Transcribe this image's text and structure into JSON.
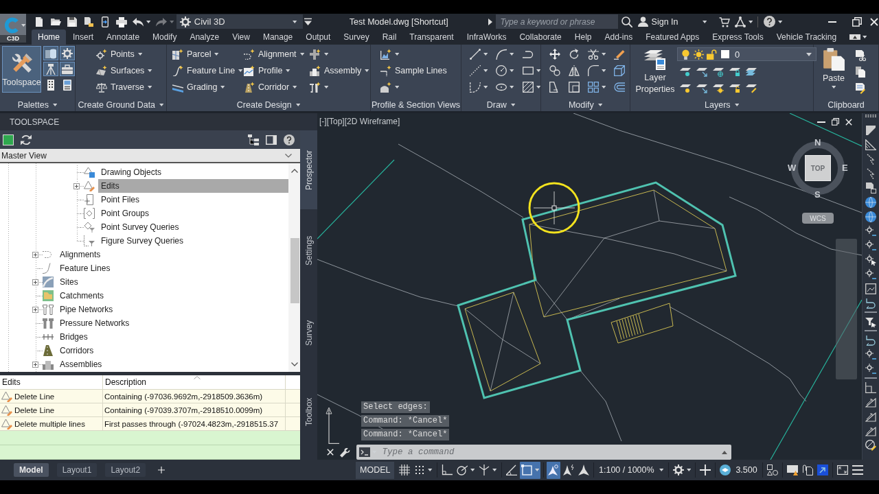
{
  "title_bar": {
    "app_button": "C3D",
    "quick_access": [
      {
        "menu": false,
        "disabled": false
      },
      {
        "menu": false,
        "disabled": false
      },
      {
        "menu": false,
        "disabled": false
      },
      {
        "menu": false,
        "disabled": false
      },
      {
        "menu": false,
        "disabled": false
      },
      {
        "menu": false,
        "disabled": false
      },
      {
        "menu": true,
        "disabled": false
      },
      {
        "menu": true,
        "disabled": true
      }
    ],
    "workspace": "Civil 3D",
    "document_title": "Test Model.dwg [Shortcut]",
    "search": {
      "placeholder": "Type a keyword or phrase"
    },
    "sign_in": "Sign In"
  },
  "ribbon": {
    "tabs": [
      {
        "label": "Home",
        "selected": true
      },
      {
        "label": "Insert",
        "selected": false
      },
      {
        "label": "Annotate",
        "selected": false
      },
      {
        "label": "Modify",
        "selected": false
      },
      {
        "label": "Analyze",
        "selected": false
      },
      {
        "label": "View",
        "selected": false
      },
      {
        "label": "Manage",
        "selected": false
      },
      {
        "label": "Output",
        "selected": false
      },
      {
        "label": "Survey",
        "selected": false
      },
      {
        "label": "Rail",
        "selected": false
      },
      {
        "label": "Transparent",
        "selected": false
      },
      {
        "label": "InfraWorks",
        "selected": false
      },
      {
        "label": "Collaborate",
        "selected": false
      },
      {
        "label": "Help",
        "selected": false
      },
      {
        "label": "Add-ins",
        "selected": false
      },
      {
        "label": "Featured Apps",
        "selected": false
      },
      {
        "label": "Express Tools",
        "selected": false
      },
      {
        "label": "Vehicle Tracking",
        "selected": false
      }
    ],
    "panels": [
      {
        "kind": "palettes",
        "title": "Palettes",
        "menu": true,
        "large": {
          "label": "Toolspace",
          "selected": true
        },
        "tools": [
          {
            "selected": true
          },
          {
            "selected": true
          },
          {
            "selected": true
          },
          {
            "selected": true
          },
          {
            "selected": false
          },
          {
            "selected": false
          }
        ]
      },
      {
        "kind": "list",
        "title": "Create Ground Data",
        "menu": true,
        "columns": [
          [
            {
              "label": "Points",
              "menu": true
            },
            {
              "label": "Surfaces",
              "menu": true
            },
            {
              "label": "Traverse",
              "menu": true
            }
          ]
        ]
      },
      {
        "kind": "list",
        "title": "Create Design",
        "menu": true,
        "columns": [
          [
            {
              "label": "Parcel",
              "menu": true
            },
            {
              "label": "Feature Line",
              "menu": true
            },
            {
              "label": "Grading",
              "menu": true
            }
          ],
          [
            {
              "label": "Alignment",
              "menu": true
            },
            {
              "label": "Profile",
              "menu": true
            },
            {
              "label": "Corridor",
              "menu": true
            }
          ],
          [
            {
              "menu": true
            },
            {
              "label": "Assembly",
              "menu": true
            },
            {
              "menu": true
            }
          ]
        ]
      },
      {
        "kind": "list",
        "title": "Profile & Section Views",
        "menu": false,
        "columns": [
          [
            {
              "menu": true
            },
            {
              "label": "Sample Lines",
              "menu": false
            },
            {
              "menu": true
            }
          ]
        ]
      },
      {
        "kind": "grid",
        "title": "Draw",
        "menu": true,
        "tools": [
          {
            "menu": true
          },
          {
            "menu": true
          },
          {
            "menu": false
          },
          {
            "menu": true
          },
          {
            "menu": true
          },
          {
            "menu": true
          },
          {
            "menu": true
          },
          {
            "menu": true
          },
          {
            "menu": true
          }
        ]
      },
      {
        "kind": "grid",
        "title": "Modify",
        "menu": true,
        "tools": [
          {
            "menu": false
          },
          {
            "menu": false
          },
          {
            "menu": true
          },
          {
            "menu": false
          },
          {
            "menu": false
          },
          {
            "menu": false
          },
          {
            "menu": true
          },
          {
            "menu": false
          },
          {
            "menu": false
          },
          {
            "menu": false
          },
          {
            "menu": true
          },
          {
            "menu": false
          }
        ]
      },
      {
        "kind": "layers",
        "title": "Layers",
        "menu": true,
        "large": {
          "label": "Layer Properties"
        },
        "current_layer": {
          "name": "0",
          "color": "#ffffff"
        }
      },
      {
        "kind": "clipboard",
        "title": "Clipboard",
        "menu": false,
        "large": {
          "label": "Paste",
          "menu": true
        }
      }
    ]
  },
  "toolspace": {
    "title": "TOOLSPACE",
    "view": "Master View",
    "tree": [
      {
        "children": [
          {
            "label": "Drawing Objects",
            "expandable": false,
            "selected": false
          },
          {
            "label": "Edits",
            "expandable": true,
            "selected": true
          },
          {
            "label": "Point Files",
            "expandable": false,
            "selected": false
          },
          {
            "label": "Point Groups",
            "expandable": false,
            "selected": false
          },
          {
            "label": "Point Survey Queries",
            "expandable": false,
            "selected": false
          },
          {
            "label": "Figure Survey Queries",
            "expandable": false,
            "selected": false
          }
        ]
      },
      {
        "label": "Alignments",
        "expandable": true,
        "selected": false
      },
      {
        "label": "Feature Lines",
        "expandable": false,
        "selected": false
      },
      {
        "label": "Sites",
        "expandable": true,
        "selected": false
      },
      {
        "label": "Catchments",
        "expandable": false,
        "selected": false
      },
      {
        "label": "Pipe Networks",
        "expandable": true,
        "selected": false
      },
      {
        "label": "Pressure Networks",
        "expandable": false,
        "selected": false
      },
      {
        "label": "Bridges",
        "expandable": false,
        "selected": false
      },
      {
        "label": "Corridors",
        "expandable": false,
        "selected": false
      },
      {
        "label": "Assemblies",
        "expandable": true,
        "selected": false
      }
    ],
    "side_tabs": [
      {
        "label": "Prospector",
        "selected": true
      },
      {
        "label": "Settings",
        "selected": false
      },
      {
        "label": "Survey",
        "selected": false
      },
      {
        "label": "Toolbox",
        "selected": false
      }
    ],
    "edits_table": {
      "columns": [
        "Edits",
        "Description"
      ],
      "rows": [
        [
          "Delete Line",
          "Containing (-97036.9692m,-2918509.3636m)"
        ],
        [
          "Delete Line",
          "Containing (-97039.3707m,-2918510.0099m)"
        ],
        [
          "Delete multiple lines",
          "First passes through (-97024.4823m,-2918515.37"
        ]
      ]
    }
  },
  "viewport": {
    "label": "[-][Top][2D Wireframe]",
    "viewcube": {
      "north": "N",
      "west": "W",
      "top": "TOP",
      "east": "E",
      "south": "S",
      "ucs": "WCS"
    },
    "command_history": [
      "Select edges:",
      "Command: *Cancel*",
      "Command: *Cancel*"
    ],
    "command_line": {
      "placeholder": "Type a command"
    }
  },
  "layout_tabs": [
    {
      "label": "Model",
      "selected": true
    },
    {
      "label": "Layout1",
      "selected": false
    },
    {
      "label": "Layout2",
      "selected": false
    }
  ],
  "status_bar": [
    {
      "kind": "button",
      "label": "MODEL"
    },
    {
      "kind": "tool",
      "selected": false,
      "menu": false
    },
    {
      "kind": "tool",
      "selected": false,
      "menu": true
    },
    {
      "kind": "tool",
      "selected": false,
      "menu": false
    },
    {
      "kind": "tool",
      "selected": false,
      "menu": true
    },
    {
      "kind": "tool",
      "selected": false,
      "menu": true
    },
    {
      "kind": "tool",
      "selected": false,
      "menu": false
    },
    {
      "kind": "tool",
      "selected": true,
      "menu": true
    },
    {
      "kind": "tool",
      "selected": true,
      "menu": false
    },
    {
      "kind": "tool",
      "selected": false,
      "menu": false
    },
    {
      "kind": "tool",
      "selected": false,
      "menu": false
    },
    {
      "kind": "dropdown",
      "label": "1:100 / 1000%"
    },
    {
      "kind": "tool",
      "selected": false,
      "menu": true
    },
    {
      "kind": "tool",
      "selected": false,
      "menu": false
    },
    {
      "kind": "tool",
      "selected": false,
      "menu": false
    },
    {
      "kind": "text",
      "label": "3.500"
    },
    {
      "kind": "tool",
      "selected": false,
      "menu": false
    },
    {
      "kind": "tool",
      "selected": false,
      "menu": false
    },
    {
      "kind": "tool",
      "selected": false,
      "menu": false
    },
    {
      "kind": "tool",
      "selected": false,
      "menu": false
    },
    {
      "kind": "tool",
      "selected": false,
      "menu": false
    },
    {
      "kind": "tool",
      "selected": false,
      "menu": false
    }
  ]
}
